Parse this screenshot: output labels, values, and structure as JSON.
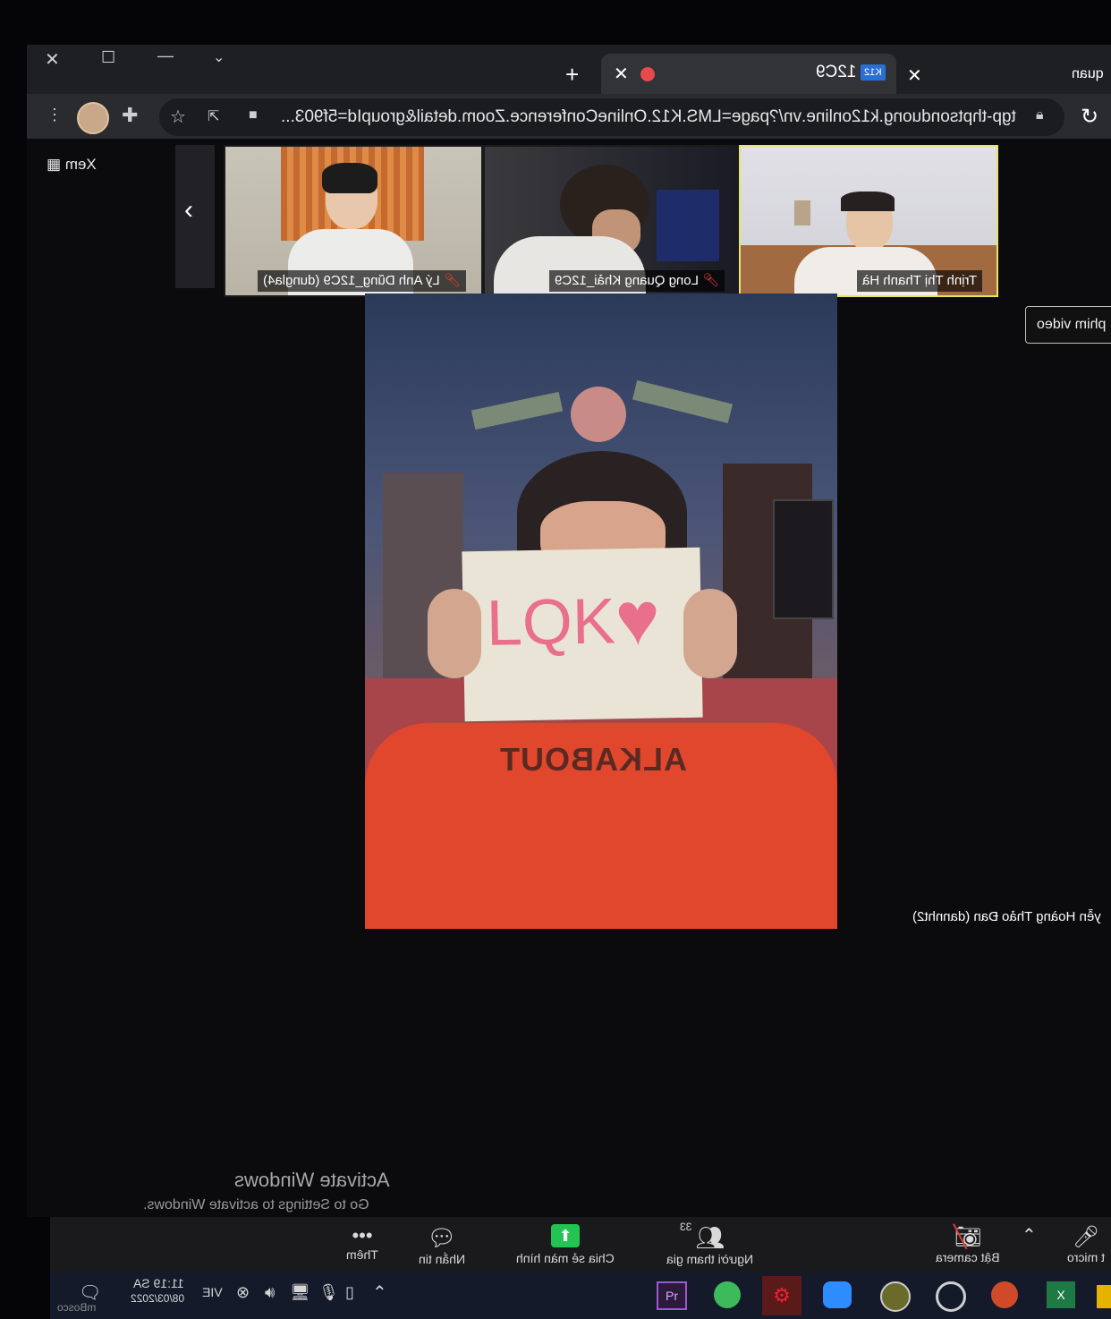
{
  "browser": {
    "tabs": [
      {
        "label": "quan"
      },
      {
        "label": "12C9",
        "badge": "K12"
      }
    ],
    "url": "tgp-thptsonduong.k12online.vn/?page=LMS.K12.OnlineConference.Zoom.detail&groupId=5f903..."
  },
  "sidebar": {
    "view_label": "Xem"
  },
  "participants": [
    {
      "name": "Lý Anh Dũng_12C9 (dungla4)"
    },
    {
      "name": "Long Quang Khải_12C9"
    },
    {
      "name": "Trịnh Thị Thanh Hà"
    }
  ],
  "main_video": {
    "speaker": "yễn Hoàng Thảo Đan (dannht2)",
    "sign_text": "LQK",
    "shirt_text": "ALKABOUT"
  },
  "film_button": {
    "label": "phim video"
  },
  "watermark": {
    "title": "Activate Windows",
    "subtitle": "Go to Settings to activate Windows."
  },
  "toolbar": {
    "micro": "t micro",
    "camera": "Bật camera",
    "participants": "Người tham gia",
    "participants_count": "33",
    "share": "Chia sẻ màn hình",
    "chat": "Nhắn tin",
    "more": "Thêm"
  },
  "taskbar": {
    "lang": "VIE",
    "time": "11:19 SA",
    "date": "08/03/2022",
    "corner_text": "mBosco"
  },
  "colors": {
    "share_green": "#23c552",
    "heart": "#e8708c",
    "shirt": "#e0472c"
  }
}
